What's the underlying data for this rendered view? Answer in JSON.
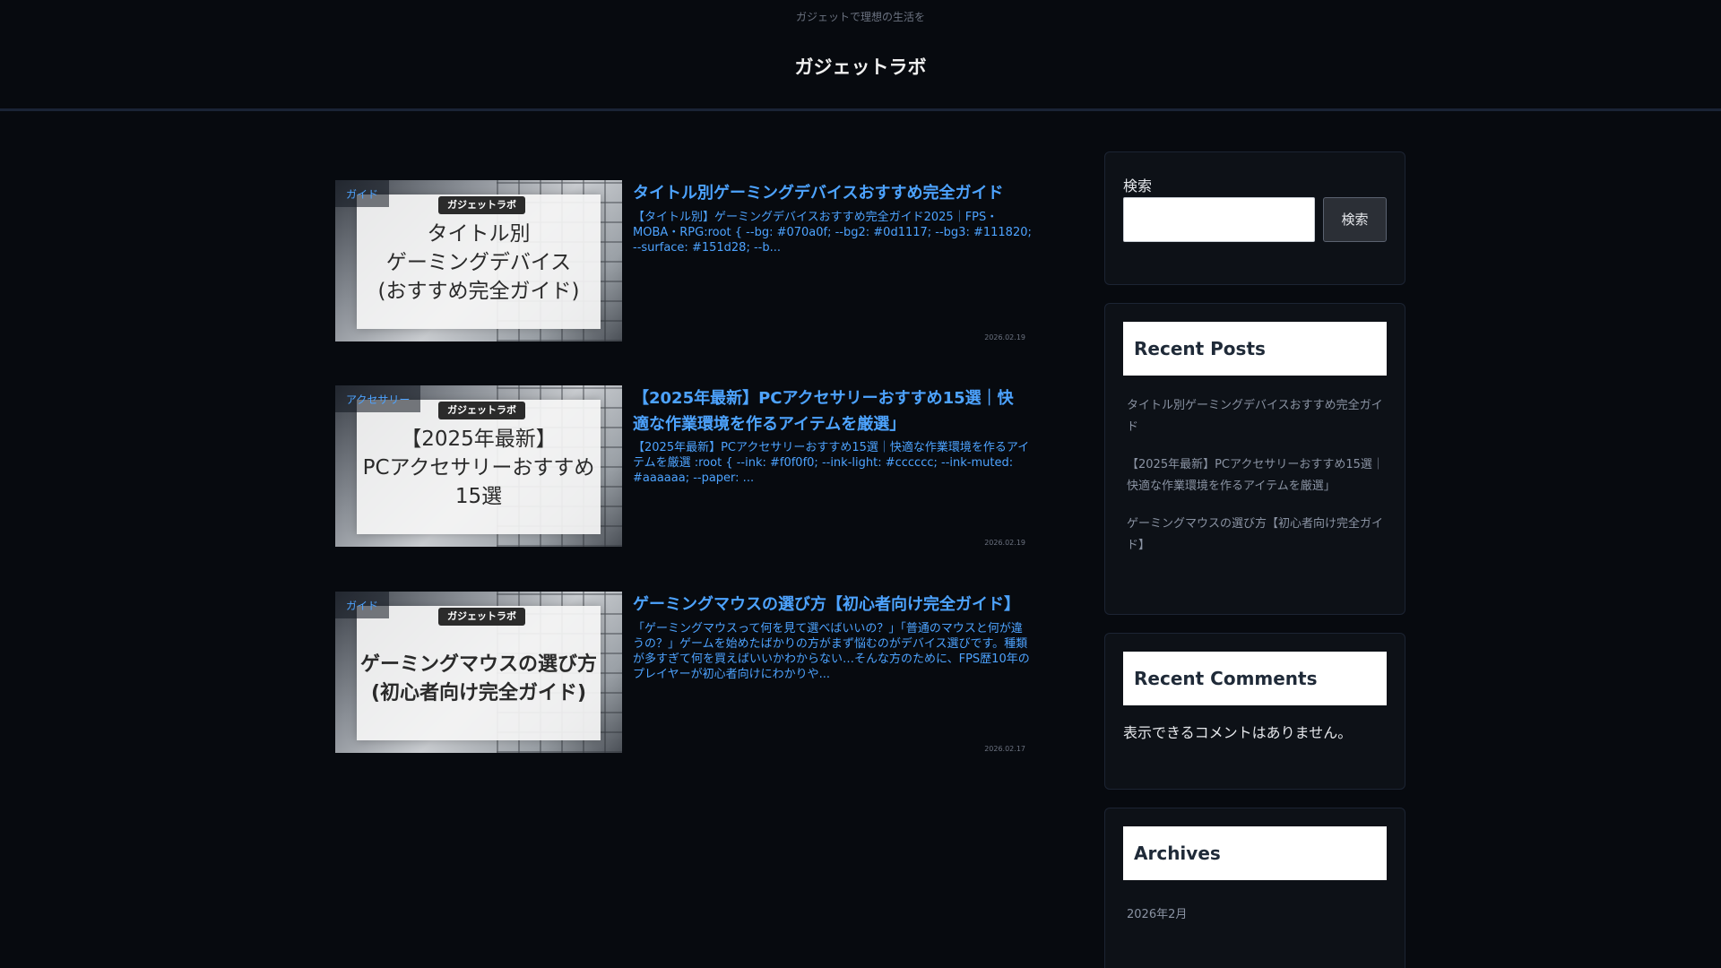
{
  "header": {
    "tagline": "ガジェットで理想の生活を",
    "site_title": "ガジェットラボ"
  },
  "posts": [
    {
      "category": "ガイド",
      "thumb_brand": "ガジェットラボ",
      "thumb_text": "タイトル別\nゲーミングデバイス\n(おすすめ完全ガイド)",
      "title": "タイトル別ゲーミングデバイスおすすめ完全ガイド",
      "excerpt": "【タイトル別】ゲーミングデバイスおすすめ完全ガイド2025｜FPS・MOBA・RPG:root { --bg: #070a0f; --bg2: #0d1117; --bg3: #111820; --surface: #151d28; --b...",
      "date": "2026.02.19"
    },
    {
      "category": "アクセサリー",
      "thumb_brand": "ガジェットラボ",
      "thumb_text": "【2025年最新】\nPCアクセサリーおすすめ\n15選",
      "title": "【2025年最新】PCアクセサリーおすすめ15選｜快適な作業環境を作るアイテムを厳選」",
      "excerpt": "【2025年最新】PCアクセサリーおすすめ15選｜快適な作業環境を作るアイテムを厳選 :root { --ink: #f0f0f0; --ink-light: #cccccc; --ink-muted: #aaaaaa; --paper: ...",
      "date": "2026.02.19"
    },
    {
      "category": "ガイド",
      "thumb_brand": "ガジェットラボ",
      "thumb_text": "ゲーミングマウスの選び方\n(初心者向け完全ガイド)",
      "title": "ゲーミングマウスの選び方【初心者向け完全ガイド】",
      "excerpt": "「ゲーミングマウスって何を見て選べばいいの？」「普通のマウスと何が違うの？」ゲームを始めたばかりの方がまず悩むのがデバイス選びです。種類が多すぎて何を買えばいいかわからない…そんな方のために、FPS歴10年のプレイヤーが初心者向けにわかりや...",
      "date": "2026.02.17"
    }
  ],
  "sidebar": {
    "search": {
      "label": "検索",
      "placeholder": "",
      "button": "検索"
    },
    "recent_posts": {
      "heading": "Recent Posts",
      "items": [
        "タイトル別ゲーミングデバイスおすすめ完全ガイド",
        "【2025年最新】PCアクセサリーおすすめ15選｜快適な作業環境を作るアイテムを厳選」",
        "ゲーミングマウスの選び方【初心者向け完全ガイド】"
      ]
    },
    "recent_comments": {
      "heading": "Recent Comments",
      "empty": "表示できるコメントはありません。"
    },
    "archives": {
      "heading": "Archives",
      "items": [
        "2026年2月"
      ]
    }
  },
  "colors": {
    "background": "#070a0f",
    "accent": "#4da3ff",
    "widget_bg": "#0d1117"
  }
}
